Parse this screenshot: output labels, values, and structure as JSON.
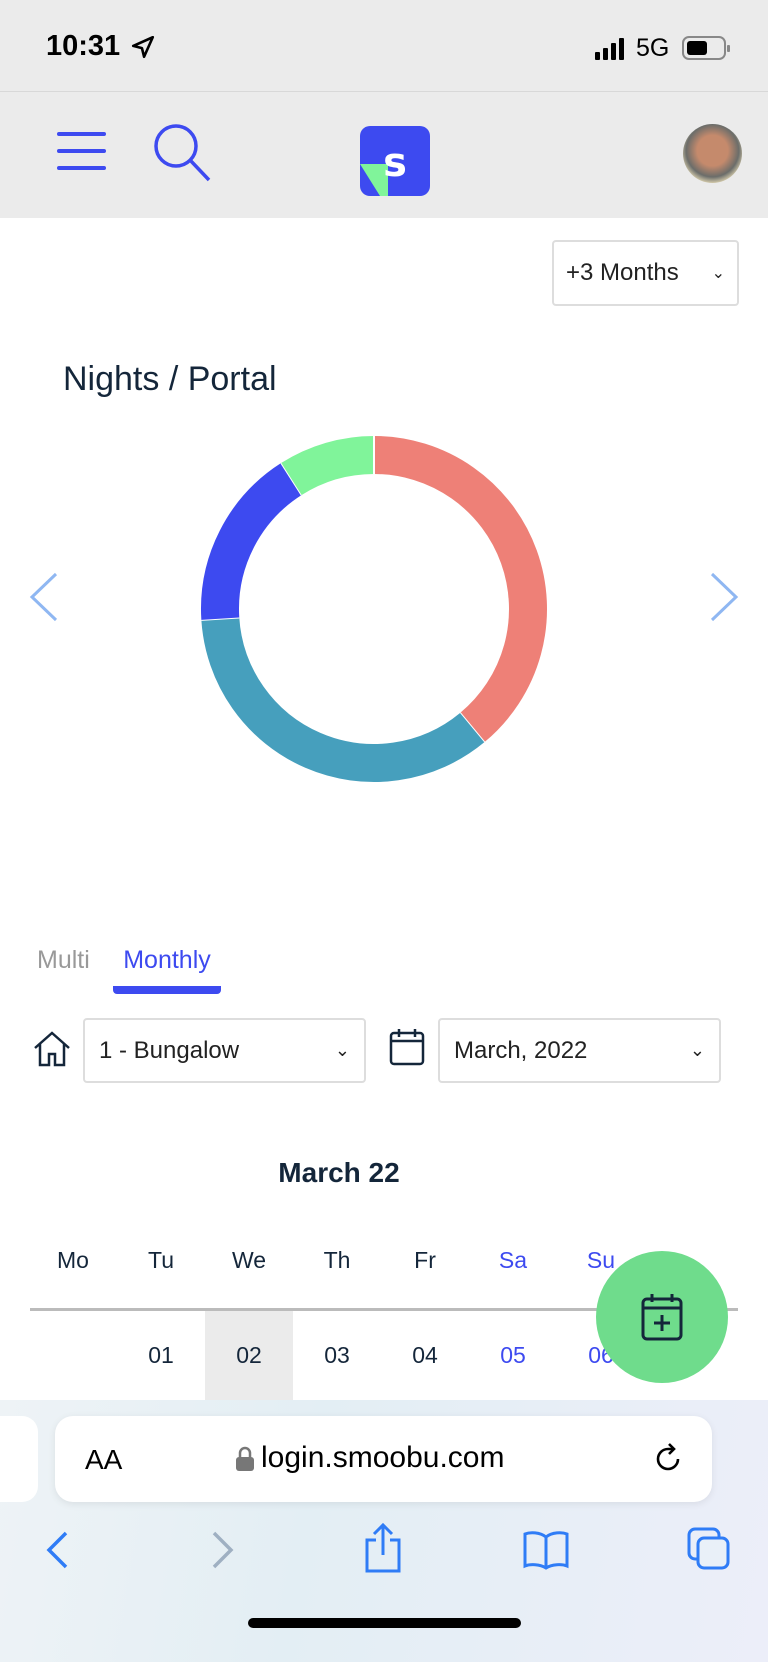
{
  "status_bar": {
    "time": "10:31",
    "network": "5G"
  },
  "header": {
    "logo_letter": "s"
  },
  "range_select": {
    "value": "+3 Months"
  },
  "chart_data": {
    "type": "pie",
    "subtype": "donut",
    "title": "Nights / Portal",
    "legend": "none",
    "series": [
      {
        "value_percent": 39,
        "color": "#ee8077"
      },
      {
        "value_percent": 35,
        "color": "#469fbd"
      },
      {
        "value_percent": 17,
        "color": "#3d4af0"
      },
      {
        "value_percent": 9,
        "color": "#80f49a"
      }
    ]
  },
  "tabs": [
    {
      "label": "Multi",
      "active": false
    },
    {
      "label": "Monthly",
      "active": true
    }
  ],
  "property_select": {
    "value": "1 - Bungalow"
  },
  "month_select": {
    "value": "March, 2022"
  },
  "calendar": {
    "title": "March 22",
    "weekdays": [
      "Mo",
      "Tu",
      "We",
      "Th",
      "Fr",
      "Sa",
      "Su"
    ],
    "first_row": [
      "",
      "01",
      "02",
      "03",
      "04",
      "05",
      "06"
    ],
    "highlighted": "02"
  },
  "browser": {
    "text_size": "AA",
    "url": "login.smoobu.com"
  },
  "colors": {
    "accent": "#3d4af0",
    "fab": "#6fdc8c",
    "weekend": "#3d4af0"
  }
}
